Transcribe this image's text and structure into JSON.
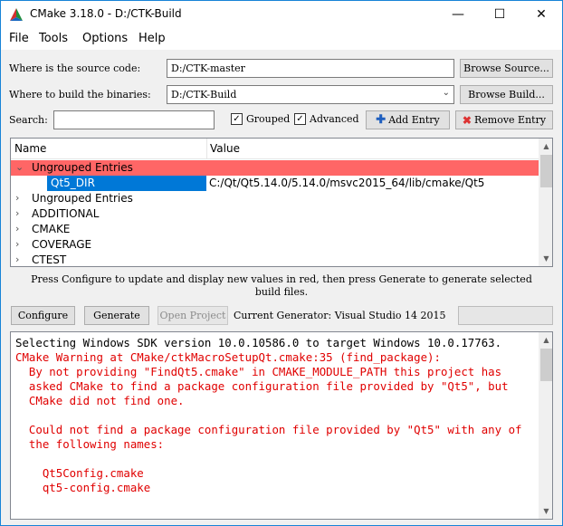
{
  "window": {
    "title": "CMake 3.18.0 - D:/CTK-Build",
    "controls": {
      "minimize": "—",
      "maximize": "☐",
      "close": "✕"
    }
  },
  "menu": [
    {
      "label": "File"
    },
    {
      "label": "Tools"
    },
    {
      "label": "Options"
    },
    {
      "label": "Help"
    }
  ],
  "source": {
    "label": "Where is the source code:",
    "value": "D:/CTK-master",
    "browse": "Browse Source..."
  },
  "build": {
    "label": "Where to build the binaries:",
    "value": "D:/CTK-Build",
    "browse": "Browse Build..."
  },
  "search": {
    "label": "Search:",
    "value": ""
  },
  "options": {
    "grouped": {
      "label": "Grouped",
      "checked": true
    },
    "advanced": {
      "label": "Advanced",
      "checked": true
    },
    "add_entry": "Add Entry",
    "remove_entry": "Remove Entry"
  },
  "tree": {
    "columns": {
      "name": "Name",
      "value": "Value"
    },
    "rows": [
      {
        "name": "Ungrouped Entries",
        "value": "",
        "expanded": true,
        "state": "group-red"
      },
      {
        "name": "Qt5_DIR",
        "value": "C:/Qt/Qt5.14.0/5.14.0/msvc2015_64/lib/cmake/Qt5",
        "state": "selected-child"
      },
      {
        "name": "Ungrouped Entries",
        "value": "",
        "expanded": false
      },
      {
        "name": "ADDITIONAL",
        "value": "",
        "expanded": false
      },
      {
        "name": "CMAKE",
        "value": "",
        "expanded": false
      },
      {
        "name": "COVERAGE",
        "value": "",
        "expanded": false
      },
      {
        "name": "CTEST",
        "value": "",
        "expanded": false
      }
    ]
  },
  "hint": {
    "line1": "Press Configure to update and display new values in red, then press Generate to generate selected",
    "line2": "build files."
  },
  "actions": {
    "configure": "Configure",
    "generate": "Generate",
    "open_project": "Open Project",
    "generator": "Current Generator: Visual Studio 14 2015"
  },
  "output": {
    "lines": [
      {
        "text": "Selecting Windows SDK version 10.0.10586.0 to target Windows 10.0.17763.",
        "color": "black"
      },
      {
        "text": "CMake Warning at CMake/ctkMacroSetupQt.cmake:35 (find_package):",
        "color": "red"
      },
      {
        "text": "  By not providing \"FindQt5.cmake\" in CMAKE_MODULE_PATH this project has",
        "color": "red"
      },
      {
        "text": "  asked CMake to find a package configuration file provided by \"Qt5\", but",
        "color": "red"
      },
      {
        "text": "  CMake did not find one.",
        "color": "red"
      },
      {
        "text": "",
        "color": "red"
      },
      {
        "text": "  Could not find a package configuration file provided by \"Qt5\" with any of",
        "color": "red"
      },
      {
        "text": "  the following names:",
        "color": "red"
      },
      {
        "text": "",
        "color": "red"
      },
      {
        "text": "    Qt5Config.cmake",
        "color": "red"
      },
      {
        "text": "    qt5-config.cmake",
        "color": "red"
      }
    ]
  },
  "colors": {
    "group_highlight": "#ff6666",
    "selection": "#0078d7",
    "warning_text": "#e00000"
  }
}
